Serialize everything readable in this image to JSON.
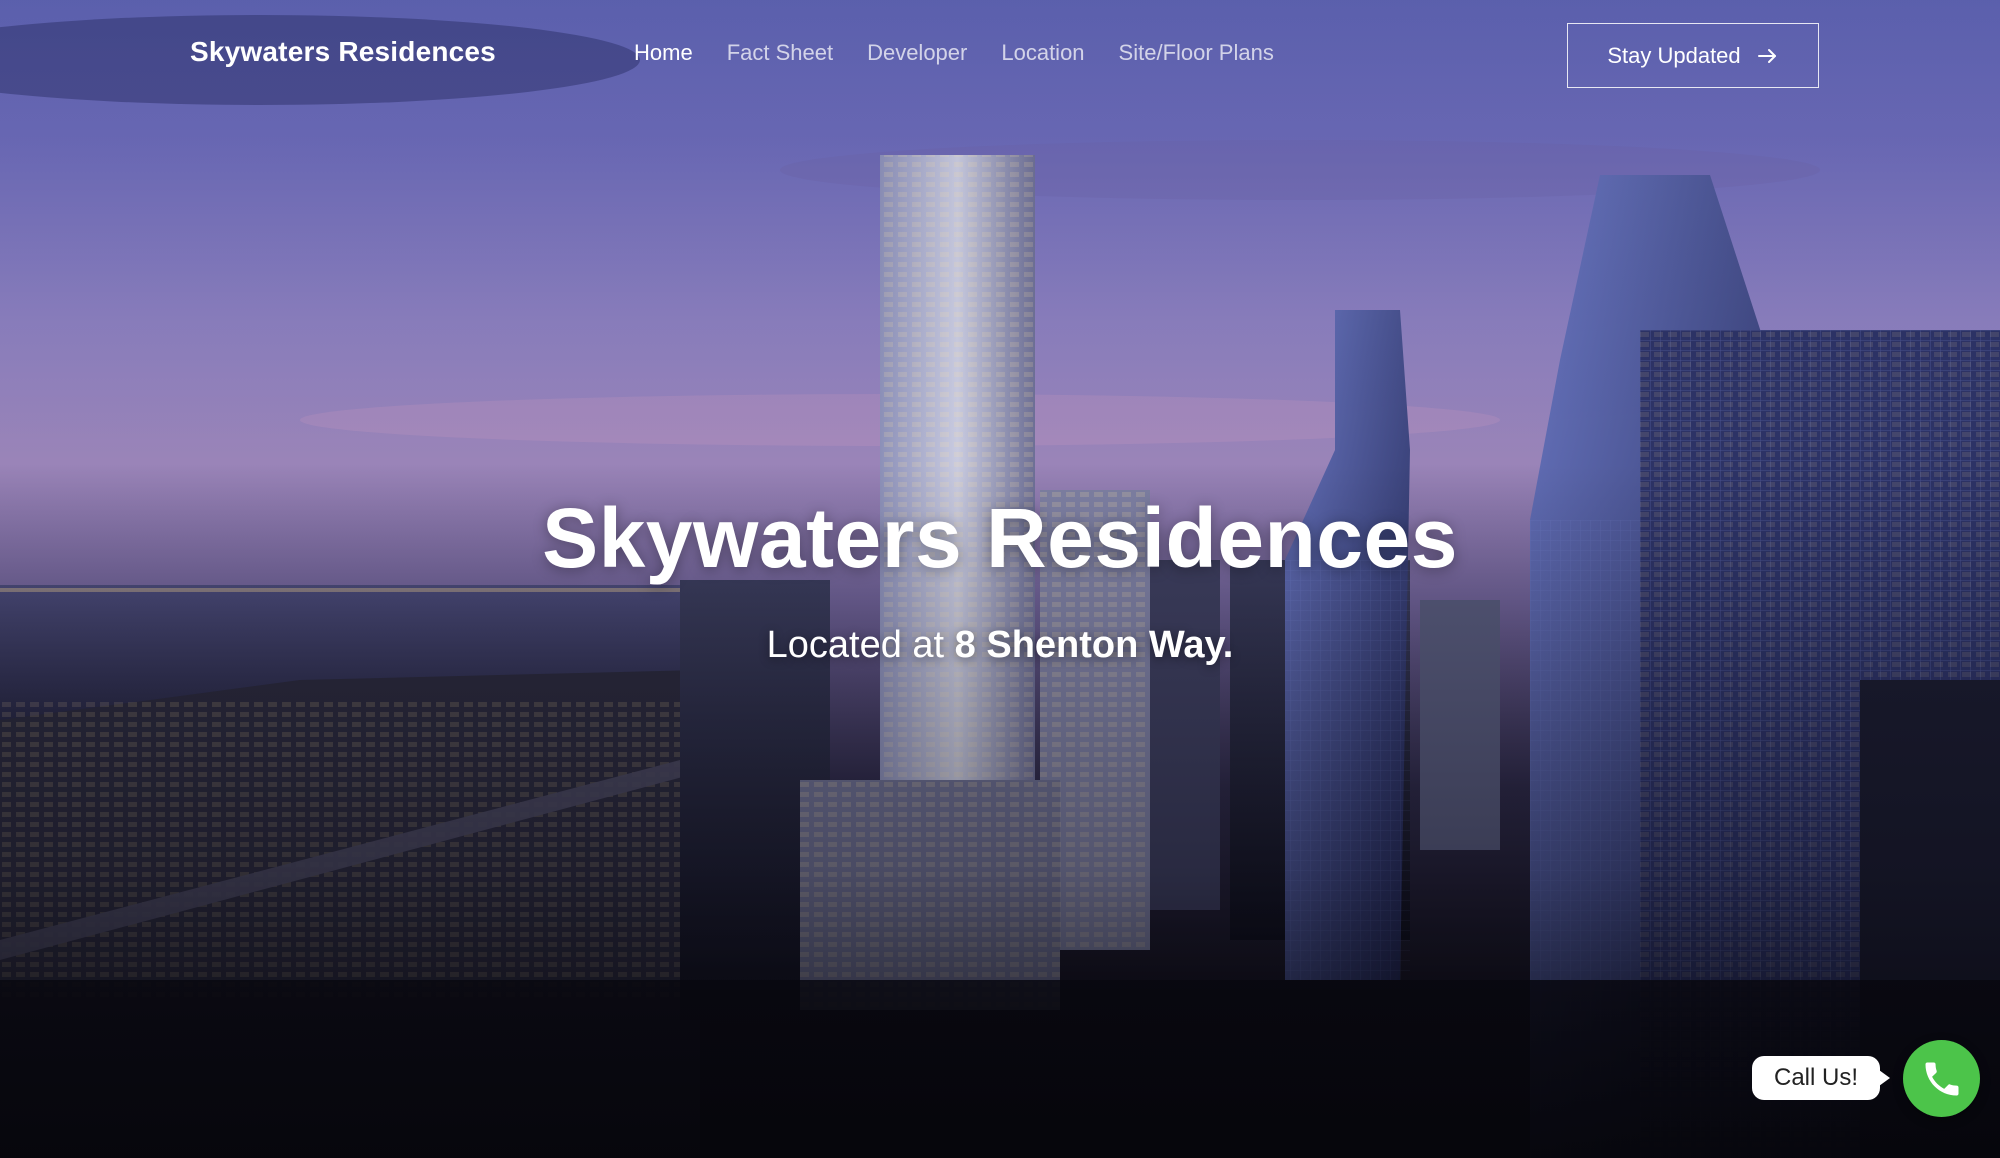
{
  "header": {
    "brand": "Skywaters Residences",
    "nav": [
      {
        "label": "Home",
        "active": true
      },
      {
        "label": "Fact Sheet",
        "active": false
      },
      {
        "label": "Developer",
        "active": false
      },
      {
        "label": "Location",
        "active": false
      },
      {
        "label": "Site/Floor Plans",
        "active": false
      }
    ],
    "cta_label": "Stay Updated",
    "cta_icon": "arrow-right-icon"
  },
  "hero": {
    "title": "Skywaters Residences",
    "subtitle_prefix": "Located at ",
    "subtitle_address": "8 Shenton Way."
  },
  "call_widget": {
    "label": "Call Us!",
    "icon": "phone-icon",
    "color": "#4cc44a"
  }
}
